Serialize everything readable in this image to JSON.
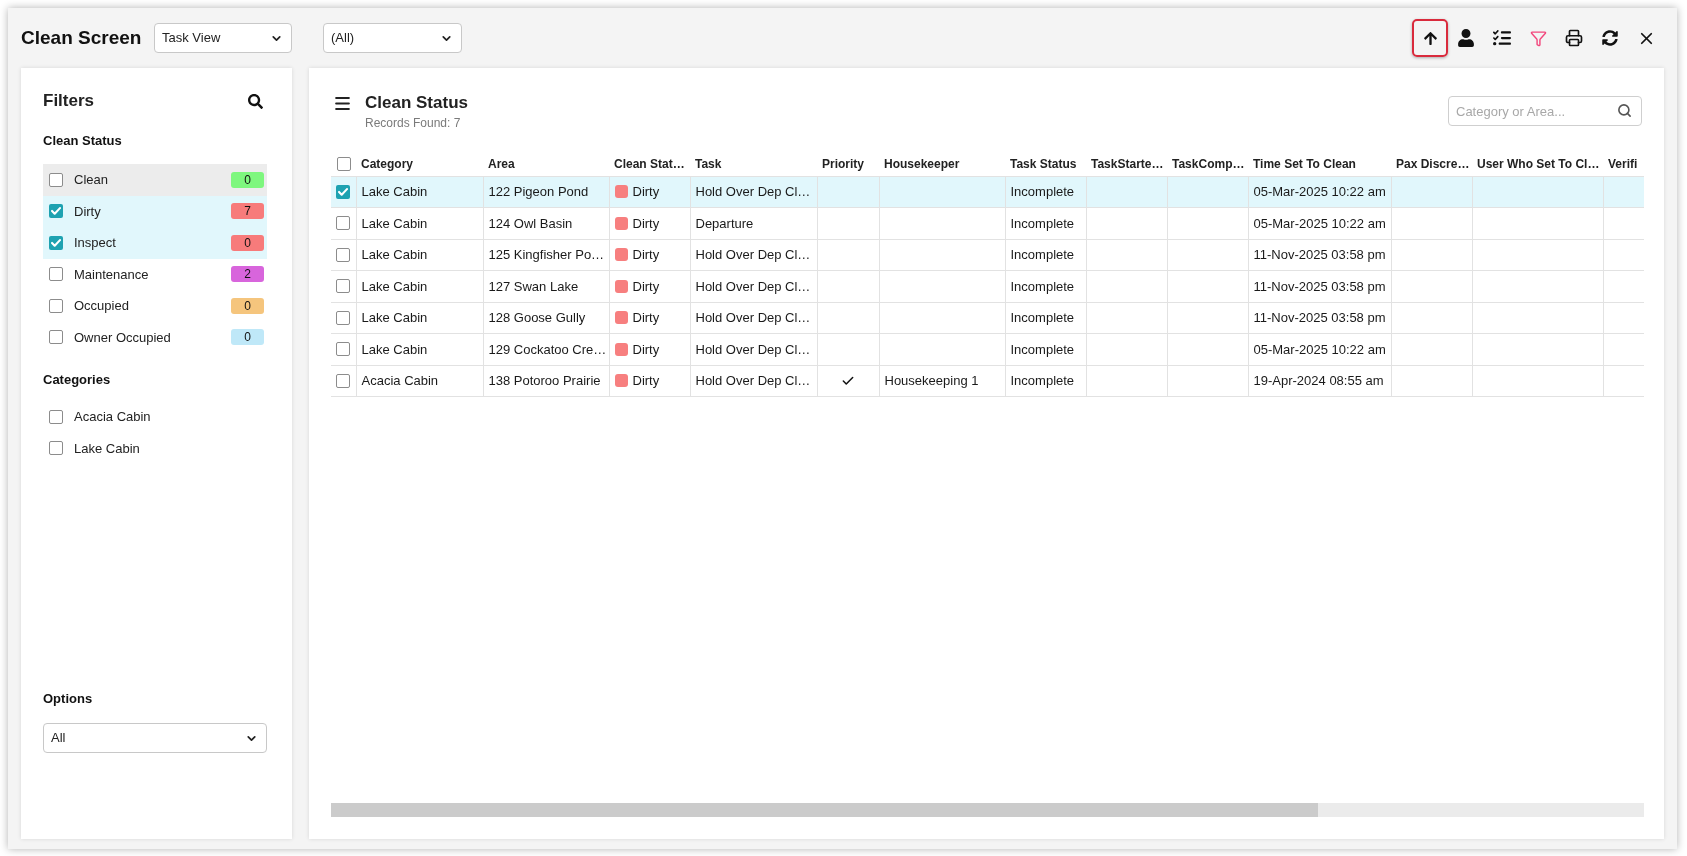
{
  "header": {
    "title": "Clean Screen",
    "view_select": {
      "value": "Task View"
    },
    "scope_select": {
      "value": "(All)"
    },
    "toolbar": [
      {
        "kind": "upload",
        "highlighted": true,
        "active": false
      },
      {
        "kind": "user",
        "highlighted": false,
        "active": false
      },
      {
        "kind": "checklist",
        "highlighted": false,
        "active": false
      },
      {
        "kind": "filter",
        "highlighted": false,
        "active": true
      },
      {
        "kind": "print",
        "highlighted": false,
        "active": false
      },
      {
        "kind": "refresh",
        "highlighted": false,
        "active": false
      },
      {
        "kind": "close",
        "highlighted": false,
        "active": false
      }
    ]
  },
  "sidebar": {
    "title": "Filters",
    "clean_status": {
      "heading": "Clean Status",
      "items": [
        {
          "label": "Clean",
          "count": "0",
          "color": "#7ef77e",
          "checked": false,
          "hovered": true
        },
        {
          "label": "Dirty",
          "count": "7",
          "color": "#f77b7b",
          "checked": true,
          "hovered": false
        },
        {
          "label": "Inspect",
          "count": "0",
          "color": "#f77b7b",
          "checked": true,
          "hovered": false
        },
        {
          "label": "Maintenance",
          "count": "2",
          "color": "#d865dc",
          "checked": false,
          "hovered": false
        },
        {
          "label": "Occupied",
          "count": "0",
          "color": "#f5c57d",
          "checked": false,
          "hovered": false
        },
        {
          "label": "Owner Occupied",
          "count": "0",
          "color": "#bfe8f8",
          "checked": false,
          "hovered": false
        }
      ]
    },
    "categories": {
      "heading": "Categories",
      "items": [
        {
          "label": "Acacia Cabin",
          "checked": false
        },
        {
          "label": "Lake Cabin",
          "checked": false
        }
      ]
    },
    "options": {
      "heading": "Options",
      "value": "All"
    }
  },
  "main": {
    "title": "Clean Status",
    "records_found": "Records Found: 7",
    "search": {
      "placeholder": "Category or Area..."
    },
    "table": {
      "select_all": {
        "checked": false
      },
      "columns": [
        "Category",
        "Area",
        "Clean Stat…",
        "Task",
        "Priority",
        "Housekeeper",
        "Task Status",
        "TaskStarte…",
        "TaskComp…",
        "Time Set To Clean",
        "Pax Discre…",
        "User Who Set To Cl…",
        "Verifi"
      ],
      "rows": [
        {
          "selected": true,
          "category": "Lake Cabin",
          "area": "122 Pigeon Pond",
          "clean_status": {
            "label": "Dirty",
            "color": "#f77f7f"
          },
          "task": "Hold Over Dep Cl…",
          "priority": false,
          "task_status": "Incomplete",
          "time_set_to_clean": "05-Mar-2025 10:22 am"
        },
        {
          "selected": false,
          "category": "Lake Cabin",
          "area": "124 Owl Basin",
          "clean_status": {
            "label": "Dirty",
            "color": "#f77f7f"
          },
          "task": "Departure",
          "priority": false,
          "task_status": "Incomplete",
          "time_set_to_clean": "05-Mar-2025 10:22 am"
        },
        {
          "selected": false,
          "category": "Lake Cabin",
          "area": "125 Kingfisher Po…",
          "clean_status": {
            "label": "Dirty",
            "color": "#f77f7f"
          },
          "task": "Hold Over Dep Cl…",
          "priority": false,
          "task_status": "Incomplete",
          "time_set_to_clean": "11-Nov-2025 03:58 pm"
        },
        {
          "selected": false,
          "category": "Lake Cabin",
          "area": "127 Swan Lake",
          "clean_status": {
            "label": "Dirty",
            "color": "#f77f7f"
          },
          "task": "Hold Over Dep Cl…",
          "priority": false,
          "task_status": "Incomplete",
          "time_set_to_clean": "11-Nov-2025 03:58 pm"
        },
        {
          "selected": false,
          "category": "Lake Cabin",
          "area": "128 Goose Gully",
          "clean_status": {
            "label": "Dirty",
            "color": "#f77f7f"
          },
          "task": "Hold Over Dep Cl…",
          "priority": false,
          "task_status": "Incomplete",
          "time_set_to_clean": "11-Nov-2025 03:58 pm"
        },
        {
          "selected": false,
          "category": "Lake Cabin",
          "area": "129 Cockatoo Cre…",
          "clean_status": {
            "label": "Dirty",
            "color": "#f77f7f"
          },
          "task": "Hold Over Dep Cl…",
          "priority": false,
          "task_status": "Incomplete",
          "time_set_to_clean": "05-Mar-2025 10:22 am"
        },
        {
          "selected": false,
          "category": "Acacia Cabin",
          "area": "138 Potoroo Prairie",
          "clean_status": {
            "label": "Dirty",
            "color": "#f77f7f"
          },
          "task": "Hold Over Dep Cl…",
          "priority": true,
          "housekeeper": "Housekeeping 1",
          "task_status": "Incomplete",
          "time_set_to_clean": "19-Apr-2024 08:55 am"
        }
      ]
    }
  }
}
